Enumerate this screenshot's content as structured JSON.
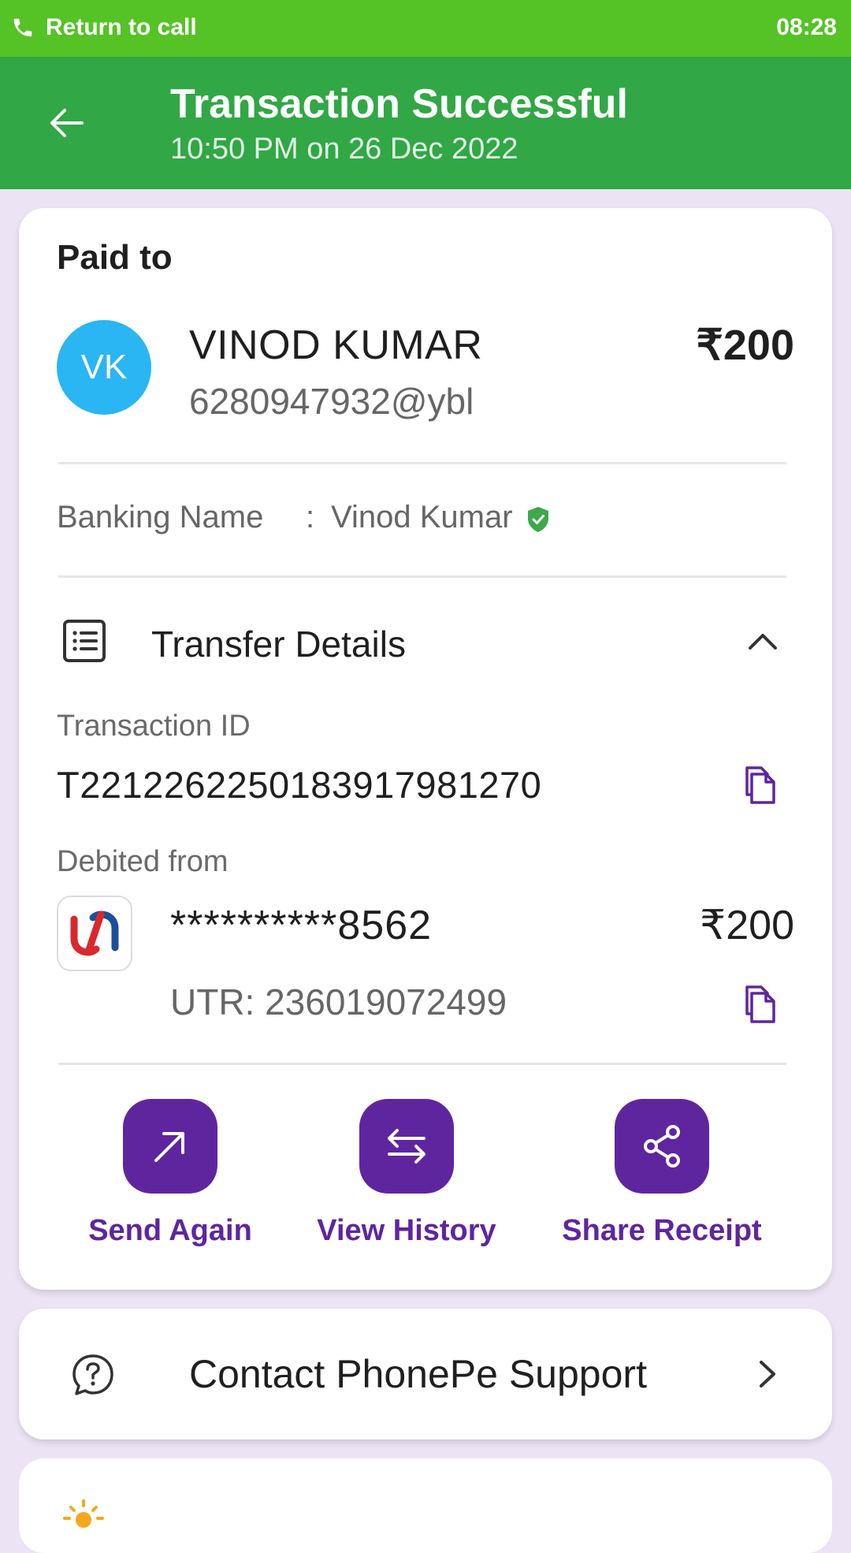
{
  "status_bar": {
    "call_label": "Return to call",
    "time": "08:28"
  },
  "header": {
    "title": "Transaction Successful",
    "subtitle": "10:50 PM on 26 Dec 2022"
  },
  "payment": {
    "paid_to_label": "Paid to",
    "avatar_initials": "VK",
    "payee_name": "VINOD KUMAR",
    "payee_upi": "6280947932@ybl",
    "amount": "₹200",
    "banking_name_label": "Banking Name",
    "banking_name_separator": ":",
    "banking_name_value": "Vinod Kumar"
  },
  "transfer_details": {
    "title": "Transfer Details",
    "transaction_id_label": "Transaction ID",
    "transaction_id": "T2212262250183917981270",
    "debited_from_label": "Debited from",
    "account_masked": "**********8562",
    "debit_amount": "₹200",
    "utr": "UTR: 236019072499"
  },
  "actions": [
    {
      "label": "Send Again",
      "icon": "arrow-up-right-icon"
    },
    {
      "label": "View History",
      "icon": "swap-arrows-icon"
    },
    {
      "label": "Share Receipt",
      "icon": "share-icon"
    }
  ],
  "support": {
    "label": "Contact PhonePe Support"
  },
  "colors": {
    "status_bar": "#55c226",
    "header": "#31a745",
    "brand_purple": "#5f259f",
    "avatar": "#29b6f2",
    "background": "#ece3f4",
    "verified": "#3ea84a"
  }
}
